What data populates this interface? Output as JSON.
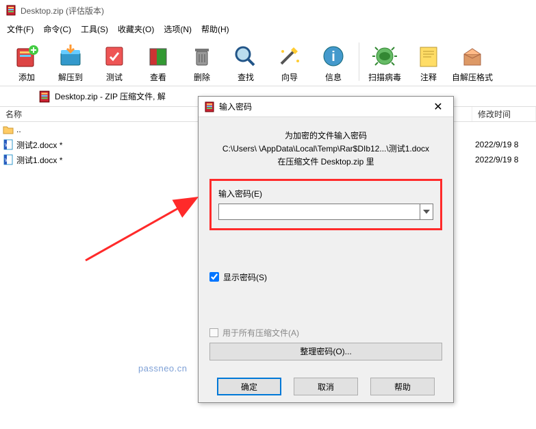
{
  "window": {
    "title": "Desktop.zip (评估版本)"
  },
  "menu": [
    "文件(F)",
    "命令(C)",
    "工具(S)",
    "收藏夹(O)",
    "选项(N)",
    "帮助(H)"
  ],
  "toolbar": [
    {
      "key": "add",
      "label": "添加"
    },
    {
      "key": "extract",
      "label": "解压到"
    },
    {
      "key": "test",
      "label": "测试"
    },
    {
      "key": "view",
      "label": "查看"
    },
    {
      "key": "delete",
      "label": "删除"
    },
    {
      "key": "find",
      "label": "查找"
    },
    {
      "key": "wizard",
      "label": "向导"
    },
    {
      "key": "info",
      "label": "信息"
    },
    {
      "key": "scan",
      "label": "扫描病毒"
    },
    {
      "key": "comment",
      "label": "注释"
    },
    {
      "key": "sfx",
      "label": "自解压格式"
    }
  ],
  "location": {
    "path": "Desktop.zip - ZIP 压缩文件, 解"
  },
  "columns": {
    "name": "名称",
    "modified": "修改时间"
  },
  "files": [
    {
      "icon": "folder-up",
      "name": "..",
      "modified": ""
    },
    {
      "icon": "docx",
      "name": "测试2.docx *",
      "modified": "2022/9/19 8"
    },
    {
      "icon": "docx",
      "name": "测试1.docx *",
      "modified": "2022/9/19 8"
    }
  ],
  "dialog": {
    "title": "输入密码",
    "msg_line1": "为加密的文件输入密码",
    "msg_line2": "C:\\Users\\                \\AppData\\Local\\Temp\\Rar$DIb12...\\测试1.docx",
    "msg_line3": "在压缩文件 Desktop.zip 里",
    "field_label": "输入密码(E)",
    "password_value": "",
    "show_pw": "显示密码(S)",
    "show_pw_checked": true,
    "all_archives": "用于所有压缩文件(A)",
    "organize": "整理密码(O)...",
    "ok": "确定",
    "cancel": "取消",
    "help": "帮助"
  },
  "watermark": "passneo.cn"
}
